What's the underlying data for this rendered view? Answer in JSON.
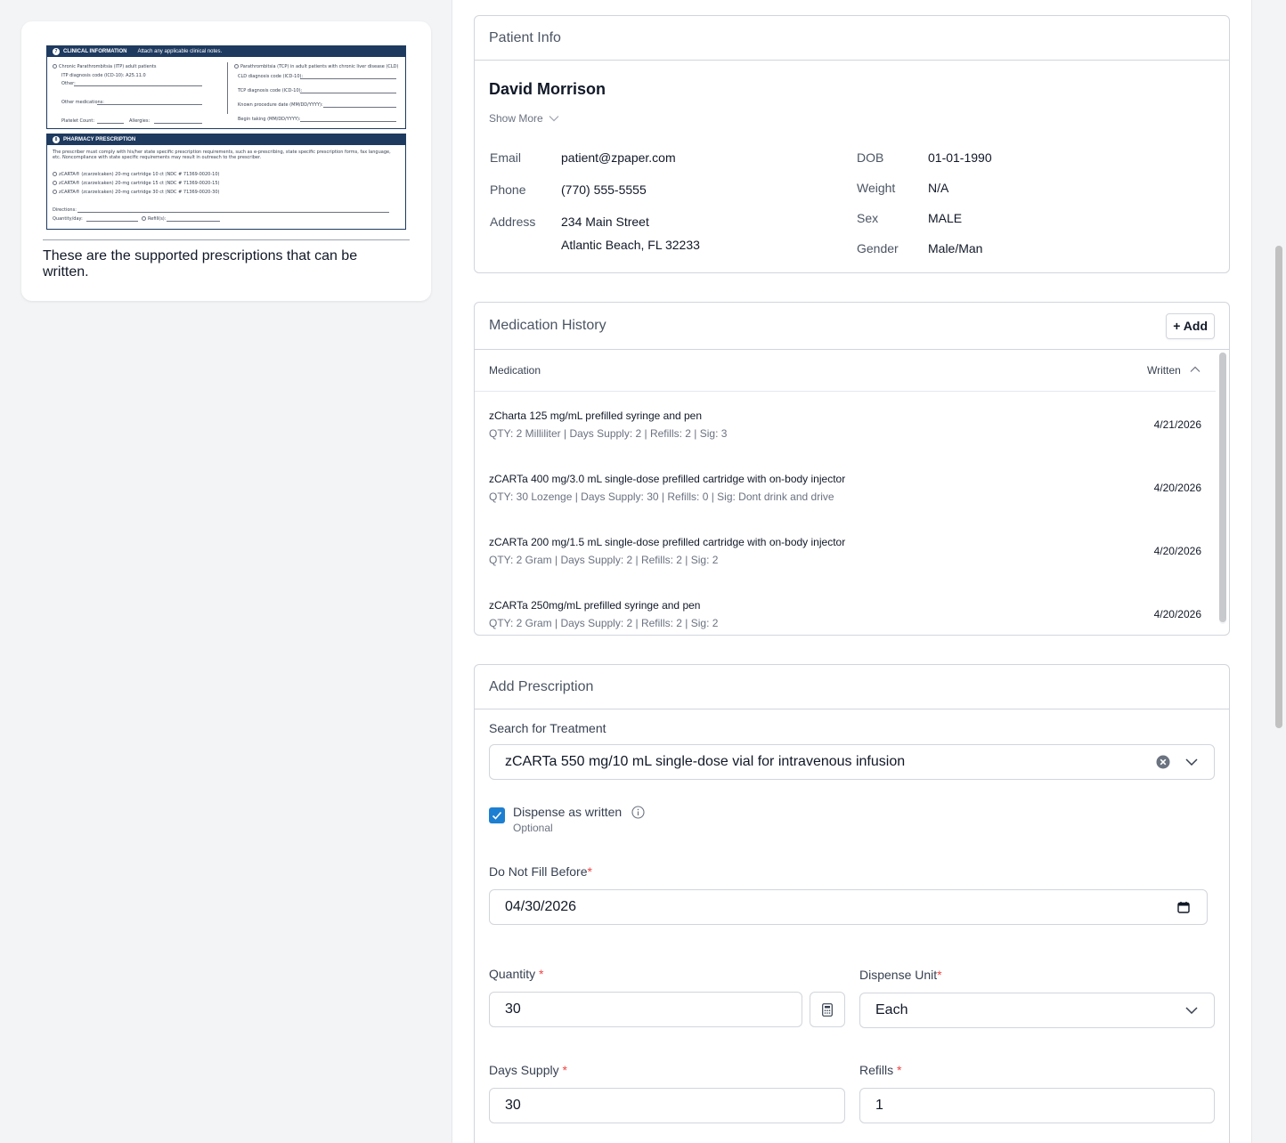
{
  "left_panel": {
    "caption": "These are the supported prescriptions that can be written.",
    "form_image": {
      "clinical": {
        "number": "7",
        "title": "CLINICAL INFORMATION",
        "subtitle": "Attach any applicable clinical notes.",
        "option_left": "Chronic Parathrombitsia (ITP) adult patients",
        "itp_code": "ITP diagnosis code (ICD-10): A25.11.0",
        "other": "Other:",
        "other_meds": "Other medications:",
        "platelet": "Platelet Count:",
        "allergies": "Allergies:",
        "option_right": "Parathrombitsia (TCP) in adult patients with chronic liver disease (CLD)",
        "cld_code": "CLD diagnosis code (ICD-10):",
        "tcp_code": "TCP diagnosis code (ICD-10):",
        "procedure_date": "Known procedure date (MM/DD/YYYY):",
        "begin_taking": "Begin taking (MM/DD/YYYY):"
      },
      "pharmacy": {
        "number": "8",
        "title": "PHARMACY PRESCRIPTION",
        "notice": "The prescriber must comply with his/her state specific prescription requirements, such as e-prescribing, state specific prescription forms, fax language, etc. Noncompliance with state specific requirements may result in outreach to the prescriber.",
        "options": [
          "zCARTA® (zcarzelcaken) 20-mg cartridge 10 ct (NDC # 71369-0020-10)",
          "zCARTA® (zcarzelcaken) 20-mg cartridge 15 ct (NDC # 71369-0020-15)",
          "zCARTA® (zcarzelcaken) 20-mg cartridge 30 ct (NDC # 71369-0020-30)"
        ],
        "directions": "Directions:",
        "quantity": "Quantity/day:",
        "refills": "Refill(s):"
      }
    }
  },
  "patient_info": {
    "title": "Patient Info",
    "name": "David Morrison",
    "show_more": "Show More",
    "fields": {
      "email_label": "Email",
      "email": "patient@zpaper.com",
      "phone_label": "Phone",
      "phone": "(770) 555-5555",
      "address_label": "Address",
      "address_line1": "234 Main Street",
      "address_line2": "Atlantic Beach, FL 32233",
      "dob_label": "DOB",
      "dob": "01-01-1990",
      "weight_label": "Weight",
      "weight": "N/A",
      "sex_label": "Sex",
      "sex": "MALE",
      "gender_label": "Gender",
      "gender": "Male/Man"
    }
  },
  "medication_history": {
    "title": "Medication History",
    "add_label": "+ Add",
    "columns": {
      "medication": "Medication",
      "written": "Written"
    },
    "rows": [
      {
        "name": "zCharta 125 mg/mL prefilled syringe and pen",
        "detail": "QTY: 2 Milliliter | Days Supply: 2 | Refills: 2 | Sig: 3",
        "written": "4/21/2026"
      },
      {
        "name": "zCARTa 400 mg/3.0 mL single-dose prefilled cartridge with on-body injector",
        "detail": "QTY: 30 Lozenge | Days Supply: 30 | Refills: 0 | Sig: Dont drink and drive",
        "written": "4/20/2026"
      },
      {
        "name": "zCARTa 200 mg/1.5 mL single-dose prefilled cartridge with on-body injector",
        "detail": "QTY: 2 Gram | Days Supply: 2 | Refills: 2 | Sig: 2",
        "written": "4/20/2026"
      },
      {
        "name": "zCARTa 250mg/mL prefilled syringe and pen",
        "detail": "QTY: 2 Gram | Days Supply: 2 | Refills: 2 | Sig: 2",
        "written": "4/20/2026"
      }
    ]
  },
  "add_prescription": {
    "title": "Add Prescription",
    "search_label": "Search for Treatment",
    "treatment": "zCARTa 550 mg/10 mL single-dose vial for intravenous infusion",
    "daw_label": "Dispense as written",
    "daw_optional": "Optional",
    "daw_checked": true,
    "dnfb_label": "Do Not Fill Before",
    "dnfb_value": "04/30/2026",
    "quantity_label": "Quantity",
    "quantity_value": "30",
    "dispense_unit_label": "Dispense Unit",
    "dispense_unit_value": "Each",
    "days_supply_label": "Days Supply",
    "days_supply_value": "30",
    "refills_label": "Refills",
    "refills_value": "1",
    "required_mark": "*"
  },
  "colors": {
    "accent": "#1d7fd1",
    "required": "#ef4444",
    "form_navy": "#1e3a5f"
  }
}
